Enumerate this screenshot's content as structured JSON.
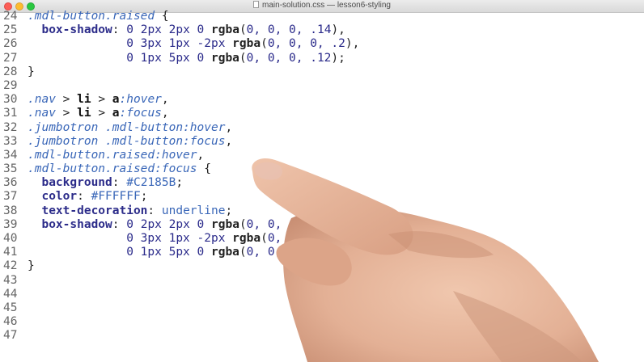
{
  "window": {
    "title": "main-solution.css — lesson6-styling"
  },
  "editor": {
    "lines": [
      {
        "n": "24",
        "tokens": [
          {
            "t": "sel",
            "v": ".mdl-button.raised"
          },
          {
            "t": "plain",
            "v": " {"
          }
        ]
      },
      {
        "n": "25",
        "tokens": [
          {
            "t": "plain",
            "v": "  "
          },
          {
            "t": "prop",
            "v": "box-shadow"
          },
          {
            "t": "plain",
            "v": ": "
          },
          {
            "t": "num",
            "v": "0 2px 2px 0 "
          },
          {
            "t": "fn",
            "v": "rgba"
          },
          {
            "t": "plain",
            "v": "("
          },
          {
            "t": "num",
            "v": "0, 0, 0, .14"
          },
          {
            "t": "plain",
            "v": "),"
          }
        ]
      },
      {
        "n": "26",
        "tokens": [
          {
            "t": "plain",
            "v": "              "
          },
          {
            "t": "num",
            "v": "0 3px 1px -2px "
          },
          {
            "t": "fn",
            "v": "rgba"
          },
          {
            "t": "plain",
            "v": "("
          },
          {
            "t": "num",
            "v": "0, 0, 0, .2"
          },
          {
            "t": "plain",
            "v": "),"
          }
        ]
      },
      {
        "n": "27",
        "tokens": [
          {
            "t": "plain",
            "v": "              "
          },
          {
            "t": "num",
            "v": "0 1px 5px 0 "
          },
          {
            "t": "fn",
            "v": "rgba"
          },
          {
            "t": "plain",
            "v": "("
          },
          {
            "t": "num",
            "v": "0, 0, 0, .12"
          },
          {
            "t": "plain",
            "v": ");"
          }
        ]
      },
      {
        "n": "28",
        "tokens": [
          {
            "t": "plain",
            "v": "}"
          }
        ]
      },
      {
        "n": "29",
        "tokens": []
      },
      {
        "n": "30",
        "tokens": [
          {
            "t": "sel",
            "v": ".nav"
          },
          {
            "t": "plain",
            "v": " > "
          },
          {
            "t": "tag",
            "v": "li"
          },
          {
            "t": "plain",
            "v": " > "
          },
          {
            "t": "tag",
            "v": "a"
          },
          {
            "t": "sel",
            "v": ":hover"
          },
          {
            "t": "plain",
            "v": ","
          }
        ]
      },
      {
        "n": "31",
        "tokens": [
          {
            "t": "sel",
            "v": ".nav"
          },
          {
            "t": "plain",
            "v": " > "
          },
          {
            "t": "tag",
            "v": "li"
          },
          {
            "t": "plain",
            "v": " > "
          },
          {
            "t": "tag",
            "v": "a"
          },
          {
            "t": "sel",
            "v": ":focus"
          },
          {
            "t": "plain",
            "v": ","
          }
        ]
      },
      {
        "n": "32",
        "tokens": [
          {
            "t": "sel",
            "v": ".jumbotron .mdl-button:hover"
          },
          {
            "t": "plain",
            "v": ","
          }
        ]
      },
      {
        "n": "33",
        "tokens": [
          {
            "t": "sel",
            "v": ".jumbotron .mdl-button:focus"
          },
          {
            "t": "plain",
            "v": ","
          }
        ]
      },
      {
        "n": "34",
        "tokens": [
          {
            "t": "sel",
            "v": ".mdl-button.raised:hover"
          },
          {
            "t": "plain",
            "v": ","
          }
        ]
      },
      {
        "n": "35",
        "tokens": [
          {
            "t": "sel",
            "v": ".mdl-button.raised:focus"
          },
          {
            "t": "plain",
            "v": " {"
          }
        ]
      },
      {
        "n": "36",
        "tokens": [
          {
            "t": "plain",
            "v": "  "
          },
          {
            "t": "prop",
            "v": "background"
          },
          {
            "t": "plain",
            "v": ": "
          },
          {
            "t": "val",
            "v": "#C2185B"
          },
          {
            "t": "plain",
            "v": ";"
          }
        ]
      },
      {
        "n": "37",
        "tokens": [
          {
            "t": "plain",
            "v": "  "
          },
          {
            "t": "prop",
            "v": "color"
          },
          {
            "t": "plain",
            "v": ": "
          },
          {
            "t": "val",
            "v": "#FFFFFF"
          },
          {
            "t": "plain",
            "v": ";"
          }
        ]
      },
      {
        "n": "38",
        "tokens": [
          {
            "t": "plain",
            "v": "  "
          },
          {
            "t": "prop",
            "v": "text-decoration"
          },
          {
            "t": "plain",
            "v": ": "
          },
          {
            "t": "val",
            "v": "underline"
          },
          {
            "t": "plain",
            "v": ";"
          }
        ]
      },
      {
        "n": "39",
        "tokens": [
          {
            "t": "plain",
            "v": "  "
          },
          {
            "t": "prop",
            "v": "box-shadow"
          },
          {
            "t": "plain",
            "v": ": "
          },
          {
            "t": "num",
            "v": "0 2px 2px 0 "
          },
          {
            "t": "fn",
            "v": "rgba"
          },
          {
            "t": "plain",
            "v": "("
          },
          {
            "t": "num",
            "v": "0, 0, 0, .14"
          },
          {
            "t": "plain",
            "v": "),"
          }
        ]
      },
      {
        "n": "40",
        "tokens": [
          {
            "t": "plain",
            "v": "              "
          },
          {
            "t": "num",
            "v": "0 3px 1px -2px "
          },
          {
            "t": "fn",
            "v": "rgba"
          },
          {
            "t": "plain",
            "v": "("
          },
          {
            "t": "num",
            "v": "0, 0, 0, .2"
          },
          {
            "t": "plain",
            "v": "),"
          }
        ]
      },
      {
        "n": "41",
        "tokens": [
          {
            "t": "plain",
            "v": "              "
          },
          {
            "t": "num",
            "v": "0 1px 5px 0 "
          },
          {
            "t": "fn",
            "v": "rgba"
          },
          {
            "t": "plain",
            "v": "("
          },
          {
            "t": "num",
            "v": "0, 0, 0, .12"
          },
          {
            "t": "plain",
            "v": ");"
          }
        ]
      },
      {
        "n": "42",
        "tokens": [
          {
            "t": "plain",
            "v": "}"
          }
        ]
      },
      {
        "n": "43",
        "tokens": []
      },
      {
        "n": "44",
        "tokens": []
      },
      {
        "n": "45",
        "tokens": []
      },
      {
        "n": "46",
        "tokens": []
      },
      {
        "n": "47",
        "tokens": []
      }
    ]
  },
  "icons": {
    "file": "css-file-icon",
    "window_controls": [
      "close-button",
      "minimize-button",
      "maximize-button"
    ]
  },
  "colors": {
    "selector": "#3a67b8",
    "property": "#2c2c8a",
    "number": "#2a2a8a",
    "skin": "#e6b9a0"
  }
}
